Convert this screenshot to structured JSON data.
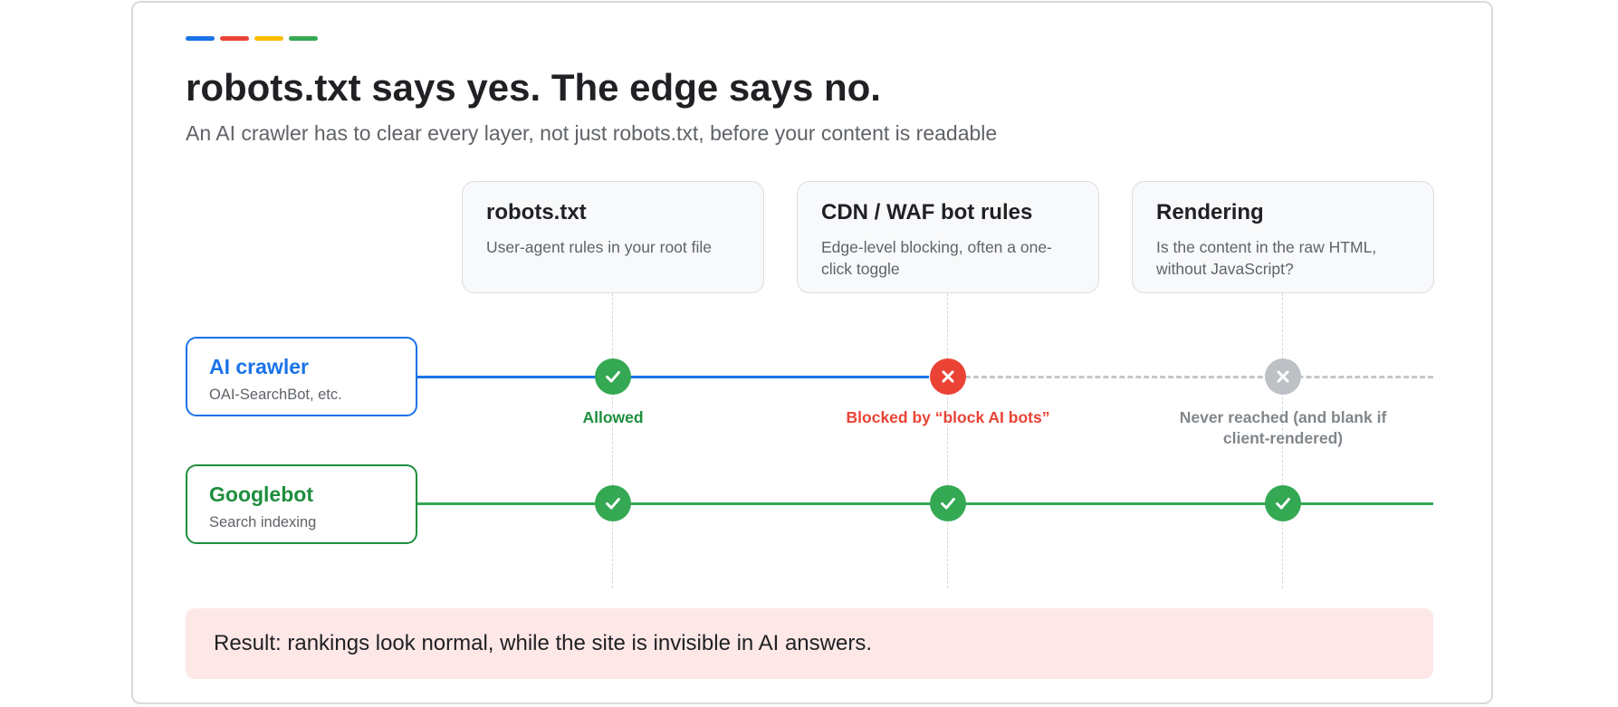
{
  "accent_colors": [
    "#1a73e8",
    "#ea4335",
    "#fbbc04",
    "#34a853"
  ],
  "title": "robots.txt says yes. The edge says no.",
  "subtitle": "An AI crawler has to clear every layer, not just robots.txt, before your content is readable",
  "layers": [
    {
      "title": "robots.txt",
      "description": "User-agent rules in your root file"
    },
    {
      "title": "CDN / WAF bot rules",
      "description": "Edge-level blocking, often a one-click toggle"
    },
    {
      "title": "Rendering",
      "description": "Is the content in the raw HTML, without JavaScript?"
    }
  ],
  "actors": [
    {
      "name": "AI crawler",
      "description": "OAI-SearchBot, etc.",
      "color": "#1a73e8",
      "checkpoints": [
        {
          "status": "allowed",
          "icon": "check-icon",
          "caption": "Allowed",
          "caption_color": "#1e8e3e"
        },
        {
          "status": "blocked",
          "icon": "x-icon",
          "caption": "Blocked by “block AI bots”",
          "caption_color": "#ea4335"
        },
        {
          "status": "not-reached",
          "icon": "x-icon",
          "caption": "Never reached (and blank if client-rendered)",
          "caption_color": "#80868b"
        }
      ]
    },
    {
      "name": "Googlebot",
      "description": "Search indexing",
      "color": "#1e8e3e",
      "checkpoints": [
        {
          "status": "allowed",
          "icon": "check-icon"
        },
        {
          "status": "allowed",
          "icon": "check-icon"
        },
        {
          "status": "allowed",
          "icon": "check-icon"
        }
      ]
    }
  ],
  "status_colors": {
    "allowed": "#34a853",
    "blocked": "#ea4335",
    "not-reached": "#bdc1c6"
  },
  "result": "Result: rankings look normal, while the site is invisible in AI answers."
}
